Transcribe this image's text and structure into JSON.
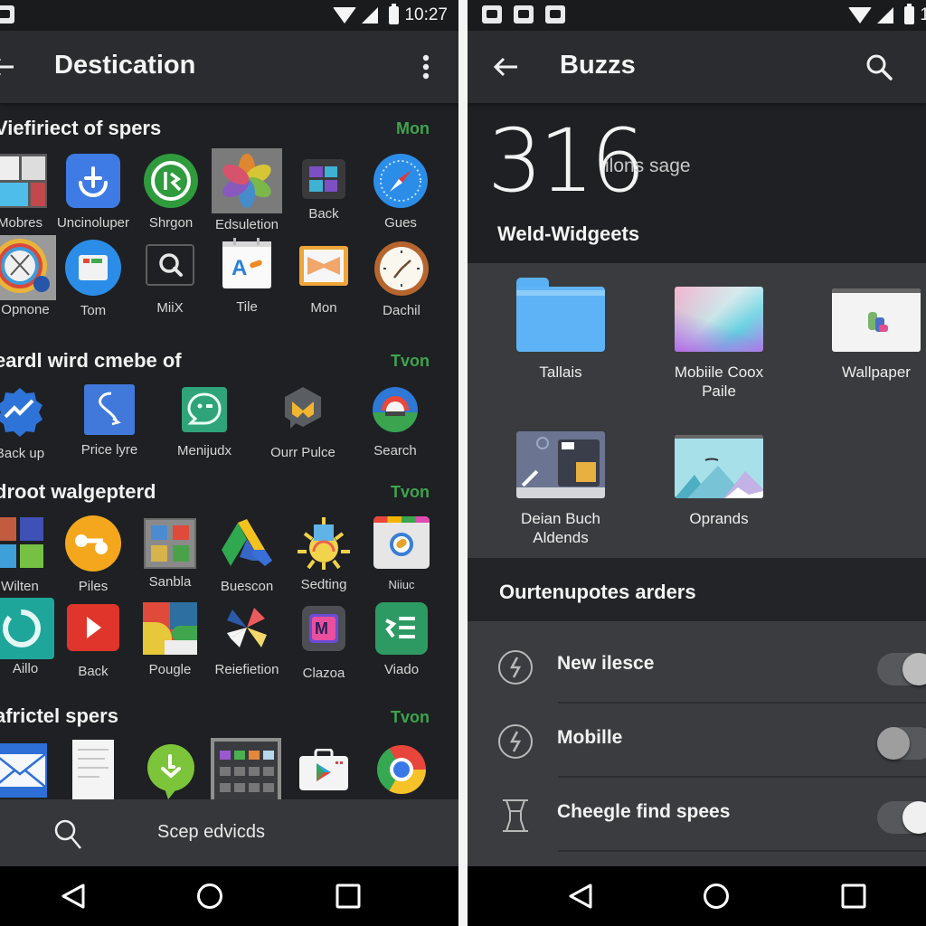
{
  "left_screen": {
    "status_bar": {
      "time": "10:27",
      "notification_icons": [
        "app-notification-icon"
      ],
      "system_icons": [
        "wifi-icon",
        "signal-icon",
        "battery-icon"
      ]
    },
    "app_bar": {
      "title": "Destication",
      "nav_icon": "back-arrow-icon",
      "action_icon": "overflow-menu-icon"
    },
    "sections": [
      {
        "title": "Viefiriect of spers",
        "more": "Mon",
        "rows": [
          [
            {
              "label": "Mobres",
              "icon": "multi-window-icon"
            },
            {
              "label": "Uncinoluper",
              "icon": "download-anchor-icon"
            },
            {
              "label": "Shrgon",
              "icon": "green-circle-app-icon"
            },
            {
              "label": "Edsuletion",
              "icon": "photos-pinwheel-icon"
            },
            {
              "label": "Back",
              "icon": "video-editor-icon"
            },
            {
              "label": "Gues",
              "icon": "compass-icon"
            }
          ],
          [
            {
              "label": "Opnone",
              "icon": "clock-dial-icon"
            },
            {
              "label": "Tom",
              "icon": "toolbox-icon"
            },
            {
              "label": "MiiX",
              "icon": "magnifier-icon"
            },
            {
              "label": "Tile",
              "icon": "calendar-icon"
            },
            {
              "label": "Mon",
              "icon": "ribbon-icon"
            },
            {
              "label": "Dachil",
              "icon": "clock-icon"
            }
          ]
        ]
      },
      {
        "title": "eardl wird cmebe of",
        "more": "Tvon",
        "rows": [
          [
            {
              "label": "Back up",
              "icon": "backup-badge-icon"
            },
            {
              "label": "Price lyre",
              "icon": "route-icon"
            },
            {
              "label": "Menijudx",
              "icon": "chat-face-icon"
            },
            {
              "label": "Ourr Pulce",
              "icon": "shield-mail-icon"
            },
            {
              "label": "Search",
              "icon": "google-search-icon"
            }
          ]
        ]
      },
      {
        "title": "droot walgepterd",
        "more": "Tvon",
        "rows": [
          [
            {
              "label": "Wilten",
              "icon": "tiles-icon"
            },
            {
              "label": "Piles",
              "icon": "orange-share-icon"
            },
            {
              "label": "Sanbla",
              "icon": "gallery-grid-icon"
            },
            {
              "label": "Buescon",
              "icon": "drive-icon"
            },
            {
              "label": "Sedting",
              "icon": "sun-gear-icon"
            },
            {
              "label": "Niiuc",
              "icon": "browser-window-icon"
            }
          ],
          [
            {
              "label": "Aillo",
              "icon": "sync-icon"
            },
            {
              "label": "Back",
              "icon": "play-video-icon"
            },
            {
              "label": "Pougle",
              "icon": "color-blocks-icon"
            },
            {
              "label": "Reiefietion",
              "icon": "pinwheel-icon"
            },
            {
              "label": "Clazoa",
              "icon": "cube-m-icon"
            },
            {
              "label": "Viado",
              "icon": "list-app-icon"
            }
          ]
        ]
      },
      {
        "title": "africtel spers",
        "more": "Tvon",
        "rows": [
          [
            {
              "label": "",
              "icon": "mail-icon"
            },
            {
              "label": "",
              "icon": "document-screenshot-icon"
            },
            {
              "label": "",
              "icon": "download-bubble-icon"
            },
            {
              "label": "",
              "icon": "app-grid-screenshot-icon"
            },
            {
              "label": "",
              "icon": "play-store-icon"
            },
            {
              "label": "",
              "icon": "chrome-icon"
            }
          ]
        ]
      }
    ],
    "bottom_search": {
      "icon": "search-icon",
      "text": "Scep edvicds"
    }
  },
  "right_screen": {
    "status_bar": {
      "time_partial": "1",
      "notification_icons": [
        "robot-icon",
        "calendar-notif-icon",
        "image-notif-icon"
      ],
      "system_icons": [
        "wifi-icon",
        "signal-icon",
        "battery-icon"
      ]
    },
    "app_bar": {
      "title": "Buzzs",
      "nav_icon": "back-arrow-icon",
      "action_icon": "search-icon"
    },
    "counter": {
      "value": "316",
      "unit": "ilons sage"
    },
    "widgets_heading": "Weld-Widgeets",
    "widgets": [
      {
        "label": "Tallais",
        "icon": "folder-icon"
      },
      {
        "label": "Mobiile Coox Paile",
        "icon": "gradient-wallpaper-icon"
      },
      {
        "label": "Wallpaper",
        "icon": "wallpaper-preview-icon"
      },
      {
        "label": "Deian Buch Aldends",
        "icon": "launcher-preview-icon"
      },
      {
        "label": "Oprands",
        "icon": "mountain-preview-icon"
      }
    ],
    "options_heading": "Ourtenupotes arders",
    "options": [
      {
        "label": "New ilesce",
        "icon": "bolt-circle-icon",
        "enabled": true
      },
      {
        "label": "Mobille",
        "icon": "bolt-circle-icon",
        "enabled": false
      },
      {
        "label": "Cheegle find spees",
        "icon": "hourglass-icon",
        "enabled": true
      }
    ]
  },
  "navigation_bar": {
    "buttons": [
      "back-triangle-icon",
      "home-circle-icon",
      "recents-square-icon"
    ]
  },
  "colors": {
    "accent_green": "#3fa34d",
    "background": "#1e2023",
    "appbar": "#2a2c2f",
    "widgets_bg": "#393b3e",
    "options_bg": "#3a3c3f"
  }
}
